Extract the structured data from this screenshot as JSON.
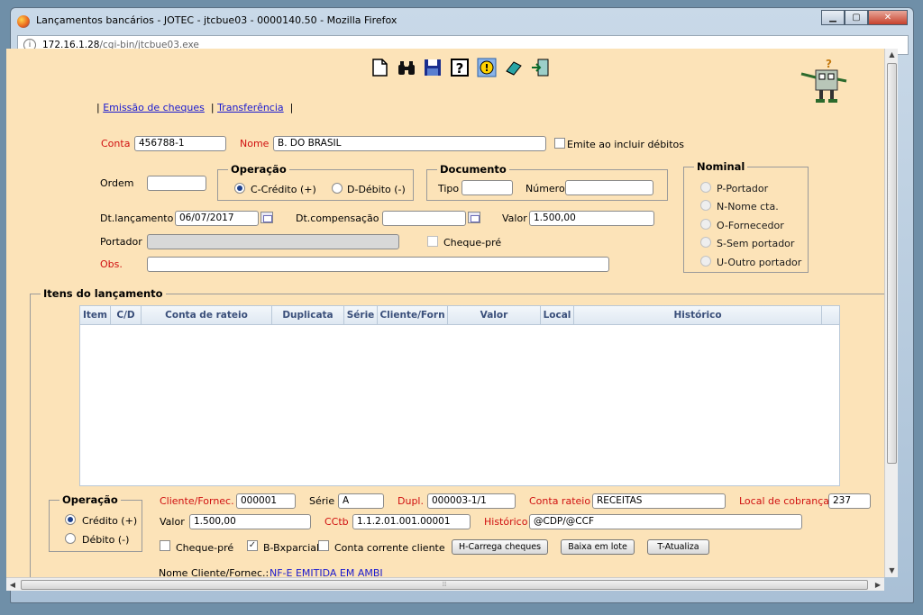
{
  "window": {
    "title": "Lançamentos bancários - JOTEC - jtcbue03 - 0000140.50 - Mozilla Firefox",
    "url_host": "172.16.1.28",
    "url_path": "/cgi-bin/jtcbue03.exe",
    "controls": {
      "minimize": "▁",
      "maximize": "▢",
      "close": "✕"
    }
  },
  "toolbar": {
    "icons": [
      "new-document-icon",
      "binoculars-search-icon",
      "save-disk-icon",
      "help-icon",
      "warning-icon",
      "eraser-icon",
      "exit-door-icon"
    ]
  },
  "links": {
    "sep": "|",
    "cheques": "Emissão de cheques",
    "transfer": "Transferência"
  },
  "header": {
    "conta_label": "Conta",
    "conta_value": "456788-1",
    "nome_label": "Nome",
    "nome_value": "B. DO BRASIL",
    "emite_label": "Emite ao incluir débitos",
    "ordem_label": "Ordem",
    "ordem_value": "",
    "operacao_legend": "Operação",
    "op_credito": "C-Crédito (+)",
    "op_debito": "D-Débito (-)",
    "documento_legend": "Documento",
    "tipo_label": "Tipo",
    "tipo_value": "",
    "numero_label": "Número",
    "numero_value": "",
    "dtlanc_label": "Dt.lançamento",
    "dtlanc_value": "06/07/2017",
    "dtcomp_label": "Dt.compensação",
    "dtcomp_value": "",
    "valor_label": "Valor",
    "valor_value": "1.500,00",
    "portador_label": "Portador",
    "portador_value": "",
    "chequepre_label": "Cheque-pré",
    "obs_label": "Obs.",
    "obs_value": ""
  },
  "nominal": {
    "legend": "Nominal",
    "options": [
      "P-Portador",
      "N-Nome cta.",
      "O-Fornecedor",
      "S-Sem portador",
      "U-Outro portador"
    ]
  },
  "itens": {
    "legend": "Itens do lançamento",
    "columns": [
      "Item",
      "C/D",
      "Conta de rateio",
      "Duplicata",
      "Série",
      "Cliente/Forn",
      "Valor",
      "Local",
      "Histórico"
    ],
    "rows": []
  },
  "footer": {
    "operacao_legend": "Operação",
    "op_credito": "Crédito (+)",
    "op_debito": "Débito (-)",
    "cliente_label": "Cliente/Fornec.",
    "cliente_value": "000001",
    "serie_label": "Série",
    "serie_value": "A",
    "dupl_label": "Dupl.",
    "dupl_value": "000003-1/1",
    "conta_rateio_label": "Conta rateio",
    "conta_rateio_value": "RECEITAS",
    "local_label": "Local de cobrança",
    "local_value": "237",
    "valor_label": "Valor",
    "valor_value": "1.500,00",
    "cctb_label": "CCtb",
    "cctb_value": "1.1.2.01.001.00001",
    "historico_label": "Histórico",
    "historico_value": "@CDP/@CCF",
    "chequepre_label": "Cheque-pré",
    "bxparcial_label": "B-Bxparcial",
    "cc_cliente_label": "Conta corrente cliente",
    "btn_carrega": "H-Carrega cheques",
    "btn_baixa": "Baixa em lote",
    "btn_atualiza": "T-Atualiza",
    "nome_cliente_label": "Nome Cliente/Fornec.:",
    "nome_cliente_value": "NF-E EMITIDA EM AMBI"
  },
  "colors": {
    "page_bg": "#fce3b8",
    "label_red": "#d01010",
    "link_blue": "#1a1ad0"
  }
}
